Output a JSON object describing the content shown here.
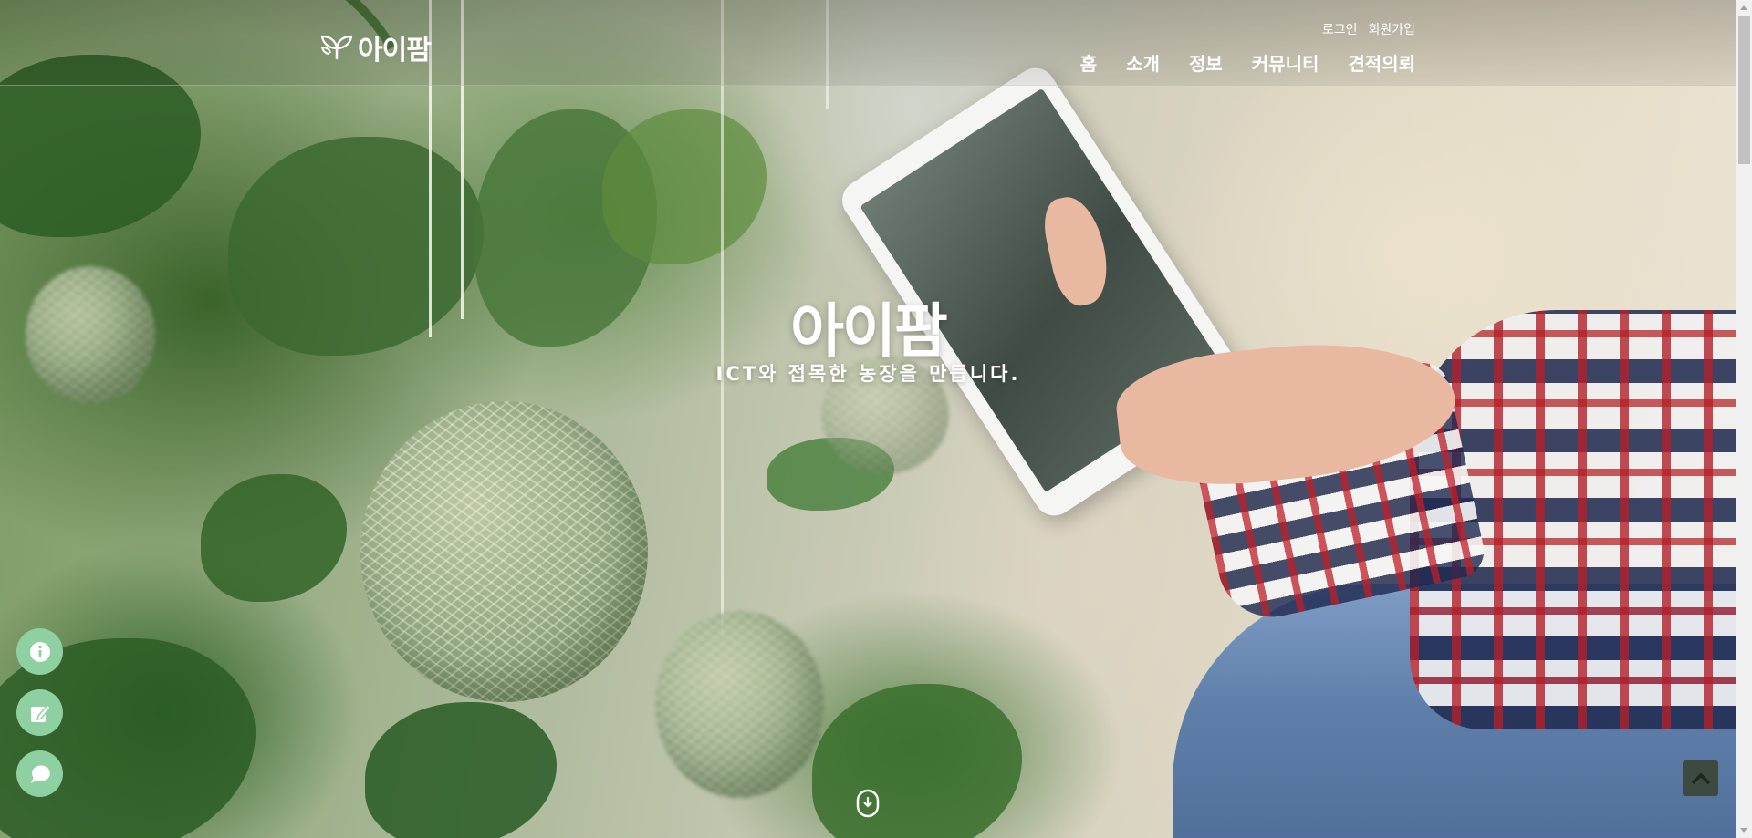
{
  "header": {
    "logo_text": "아이팜",
    "logo_icon": "sprout-icon",
    "util_links": [
      "로그인",
      "회원가입"
    ],
    "nav": [
      "홈",
      "소개",
      "정보",
      "커뮤니티",
      "견적의뢰"
    ]
  },
  "hero": {
    "title": "아이팜",
    "subtitle": "ICT와 접목한 농장을 만듭니다."
  },
  "quick_menu": [
    {
      "icon": "info-icon"
    },
    {
      "icon": "edit-icon"
    },
    {
      "icon": "chat-icon"
    }
  ],
  "scroll_down_icon": "mouse-scroll-icon",
  "top_button_icon": "chevron-up-icon",
  "colors": {
    "quick_button": "#8fd0a2",
    "top_button": "#3d4a3f",
    "text": "#ffffff"
  }
}
